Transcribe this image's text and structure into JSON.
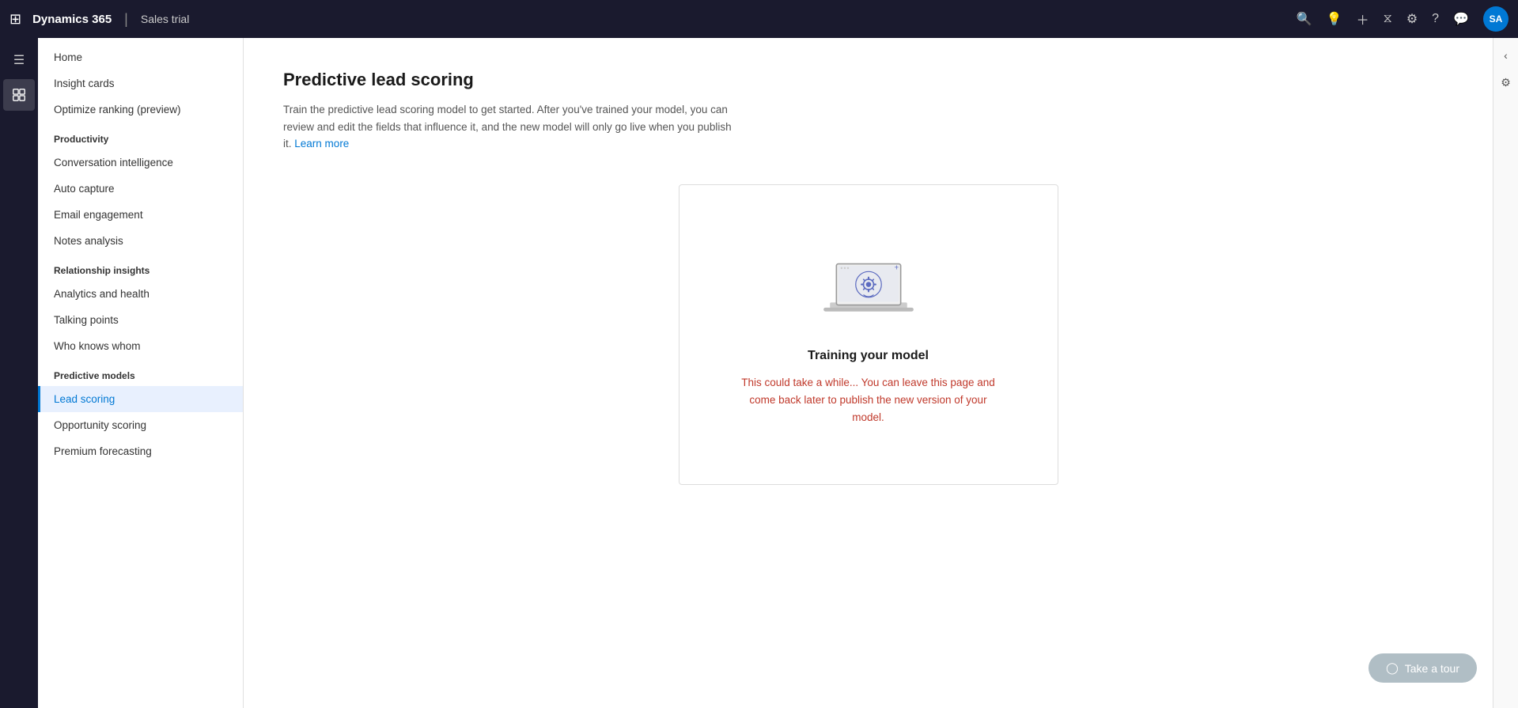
{
  "topnav": {
    "brand": "Dynamics 365",
    "separator": "|",
    "trial": "Sales trial",
    "avatar": "SA"
  },
  "sidebar": {
    "home_label": "Home",
    "nav_items": [
      {
        "id": "home",
        "label": "Home",
        "section": null,
        "active": false
      },
      {
        "id": "insight-cards",
        "label": "Insight cards",
        "section": null,
        "active": false
      },
      {
        "id": "optimize-ranking",
        "label": "Optimize ranking (preview)",
        "section": null,
        "active": false
      },
      {
        "id": "productivity-header",
        "label": "Productivity",
        "section": true
      },
      {
        "id": "conversation-intelligence",
        "label": "Conversation intelligence",
        "section": null,
        "active": false
      },
      {
        "id": "auto-capture",
        "label": "Auto capture",
        "section": null,
        "active": false
      },
      {
        "id": "email-engagement",
        "label": "Email engagement",
        "section": null,
        "active": false
      },
      {
        "id": "notes-analysis",
        "label": "Notes analysis",
        "section": null,
        "active": false
      },
      {
        "id": "relationship-insights-header",
        "label": "Relationship insights",
        "section": true
      },
      {
        "id": "analytics-health",
        "label": "Analytics and health",
        "section": null,
        "active": false
      },
      {
        "id": "talking-points",
        "label": "Talking points",
        "section": null,
        "active": false
      },
      {
        "id": "who-knows-whom",
        "label": "Who knows whom",
        "section": null,
        "active": false
      },
      {
        "id": "predictive-models-header",
        "label": "Predictive models",
        "section": true
      },
      {
        "id": "lead-scoring",
        "label": "Lead scoring",
        "section": null,
        "active": true
      },
      {
        "id": "opportunity-scoring",
        "label": "Opportunity scoring",
        "section": null,
        "active": false
      },
      {
        "id": "premium-forecasting",
        "label": "Premium forecasting",
        "section": null,
        "active": false
      }
    ]
  },
  "content": {
    "title": "Predictive lead scoring",
    "description": "Train the predictive lead scoring model to get started. After you've trained your model, you can review and edit the fields that influence it, and the new model will only go live when you publish it.",
    "learn_more_label": "Learn more",
    "training_card": {
      "title": "Training your model",
      "description": "This could take a while... You can leave this page and come back later to publish the new version of your model."
    }
  },
  "tour_button": {
    "label": "Take a tour"
  }
}
